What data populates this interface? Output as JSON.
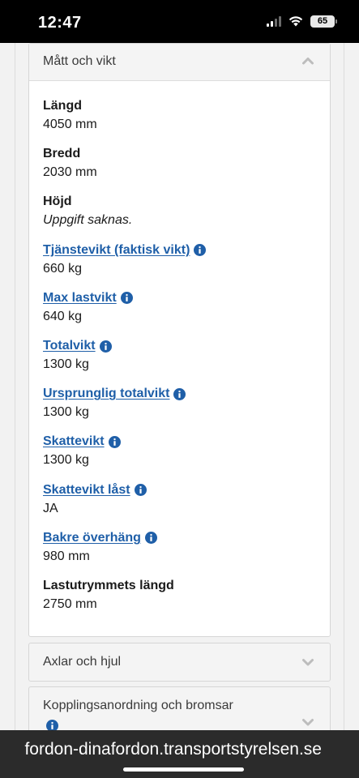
{
  "status_bar": {
    "time": "12:47",
    "battery": "65"
  },
  "section_dimensions": {
    "title": "Mått och vikt",
    "fields": [
      {
        "label": "Längd",
        "value": "4050 mm",
        "link": false,
        "info": false
      },
      {
        "label": "Bredd",
        "value": "2030 mm",
        "link": false,
        "info": false
      },
      {
        "label": "Höjd",
        "value": "Uppgift saknas.",
        "link": false,
        "info": false,
        "italic": true
      },
      {
        "label": "Tjänstevikt (faktisk vikt)",
        "value": "660 kg",
        "link": true,
        "info": true
      },
      {
        "label": "Max lastvikt",
        "value": "640 kg",
        "link": true,
        "info": true
      },
      {
        "label": "Totalvikt",
        "value": "1300 kg",
        "link": true,
        "info": true
      },
      {
        "label": "Ursprunglig totalvikt",
        "value": "1300 kg",
        "link": true,
        "info": true
      },
      {
        "label": "Skattevikt",
        "value": "1300 kg",
        "link": true,
        "info": true
      },
      {
        "label": "Skattevikt låst",
        "value": "JA",
        "link": true,
        "info": true
      },
      {
        "label": "Bakre överhäng",
        "value": "980 mm",
        "link": true,
        "info": true
      },
      {
        "label": "Lastutrymmets längd",
        "value": "2750 mm",
        "link": false,
        "info": false
      }
    ]
  },
  "section_axles": {
    "title": "Axlar och hjul"
  },
  "section_coupling": {
    "title": "Kopplingsanordning och bromsar"
  },
  "url_bar": {
    "text": "fordon-dinafordon.transportstyrelsen.se"
  },
  "colors": {
    "link": "#1f5fa8",
    "info_icon": "#1f5fa8",
    "url_bar_bg": "#2b2b2b",
    "panel_header_bg": "#f4f4f4"
  }
}
